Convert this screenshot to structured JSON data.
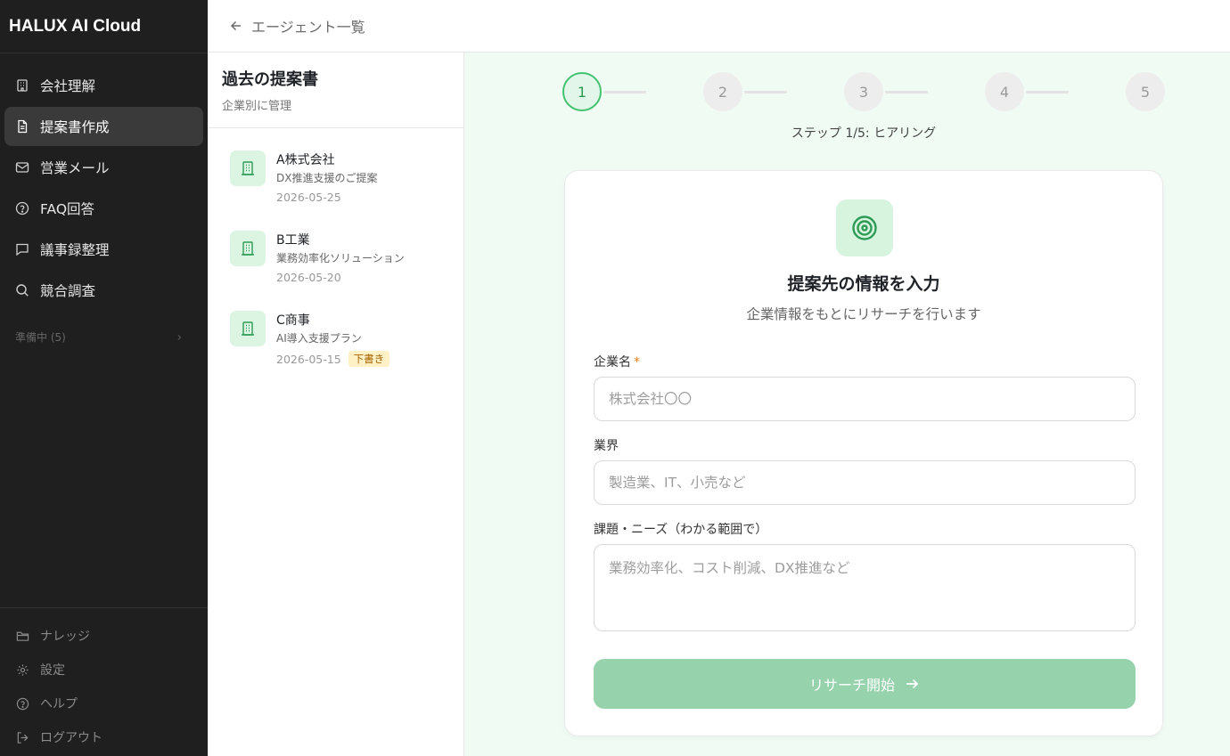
{
  "sidebar": {
    "brand": "HALUX AI Cloud",
    "items": [
      {
        "label": "会社理解",
        "icon": "building-icon"
      },
      {
        "label": "提案書作成",
        "icon": "document-icon",
        "active": true
      },
      {
        "label": "営業メール",
        "icon": "mail-icon"
      },
      {
        "label": "FAQ回答",
        "icon": "help-circle-icon"
      },
      {
        "label": "議事録整理",
        "icon": "message-square-icon"
      },
      {
        "label": "競合調査",
        "icon": "search-icon"
      }
    ],
    "pending_label": "準備中 (5)",
    "bottom_items": [
      {
        "label": "ナレッジ",
        "icon": "folder-icon"
      },
      {
        "label": "設定",
        "icon": "gear-icon"
      },
      {
        "label": "ヘルプ",
        "icon": "help-circle-icon"
      },
      {
        "label": "ログアウト",
        "icon": "logout-icon"
      }
    ]
  },
  "header": {
    "back_label": "エージェント一覧"
  },
  "history": {
    "title": "過去の提案書",
    "subtitle": "企業別に管理",
    "items": [
      {
        "company": "A株式会社",
        "title": "DX推進支援のご提案",
        "date": "2026-05-25"
      },
      {
        "company": "B工業",
        "title": "業務効率化ソリューション",
        "date": "2026-05-20"
      },
      {
        "company": "C商事",
        "title": "AI導入支援プラン",
        "date": "2026-05-15",
        "badge": "下書き"
      }
    ]
  },
  "stepper": {
    "steps": [
      "1",
      "2",
      "3",
      "4",
      "5"
    ],
    "current": 1,
    "label": "ステップ 1/5: ヒアリング"
  },
  "form": {
    "title": "提案先の情報を入力",
    "subtitle": "企業情報をもとにリサーチを行います",
    "company_label": "企業名",
    "required_mark": "*",
    "company_placeholder": "株式会社〇〇",
    "industry_label": "業界",
    "industry_placeholder": "製造業、IT、小売など",
    "needs_label": "課題・ニーズ（わかる範囲で）",
    "needs_placeholder": "業務効率化、コスト削減、DX推進など",
    "submit_label": "リサーチ開始"
  },
  "colors": {
    "accent": "#2d9b56",
    "sidebar_bg": "#1f1f1f",
    "main_bg": "#f0fbf4",
    "submit_disabled": "#96d3ad"
  }
}
